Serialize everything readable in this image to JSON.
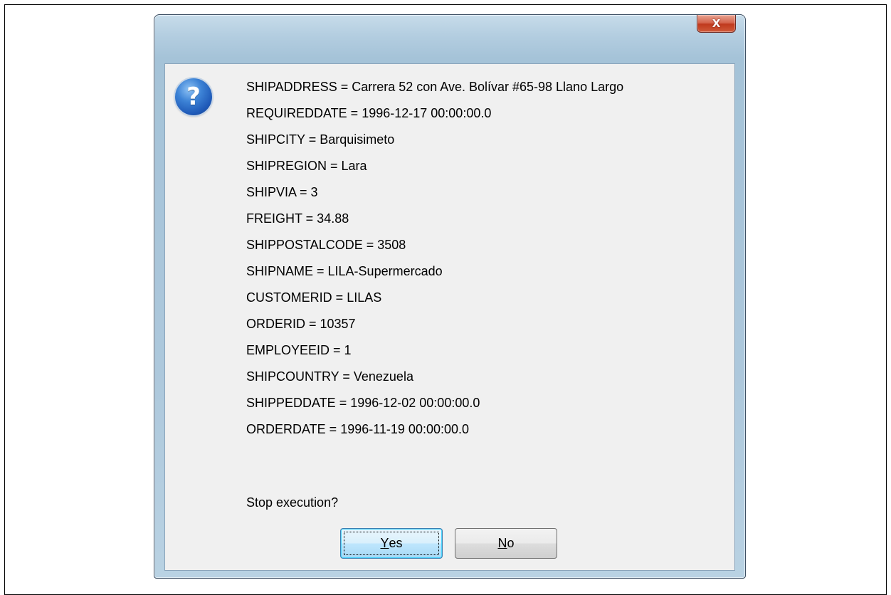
{
  "dialog": {
    "close_icon": "close-icon",
    "close_glyph": "X",
    "icon": "question-icon",
    "icon_glyph": "?",
    "message_lines": [
      "SHIPADDRESS = Carrera 52 con Ave. Bolívar #65-98 Llano Largo",
      "REQUIREDDATE = 1996-12-17 00:00:00.0",
      "SHIPCITY = Barquisimeto",
      "SHIPREGION = Lara",
      "SHIPVIA = 3",
      "FREIGHT = 34.88",
      "SHIPPOSTALCODE = 3508",
      "SHIPNAME = LILA-Supermercado",
      "CUSTOMERID = LILAS",
      "ORDERID = 10357",
      "EMPLOYEEID = 1",
      "SHIPCOUNTRY = Venezuela",
      "SHIPPEDDATE = 1996-12-02 00:00:00.0",
      "ORDERDATE = 1996-11-19 00:00:00.0"
    ],
    "prompt": "Stop execution?",
    "buttons": {
      "yes": {
        "mnemonic": "Y",
        "rest": "es"
      },
      "no": {
        "mnemonic": "N",
        "rest": "o"
      }
    }
  }
}
